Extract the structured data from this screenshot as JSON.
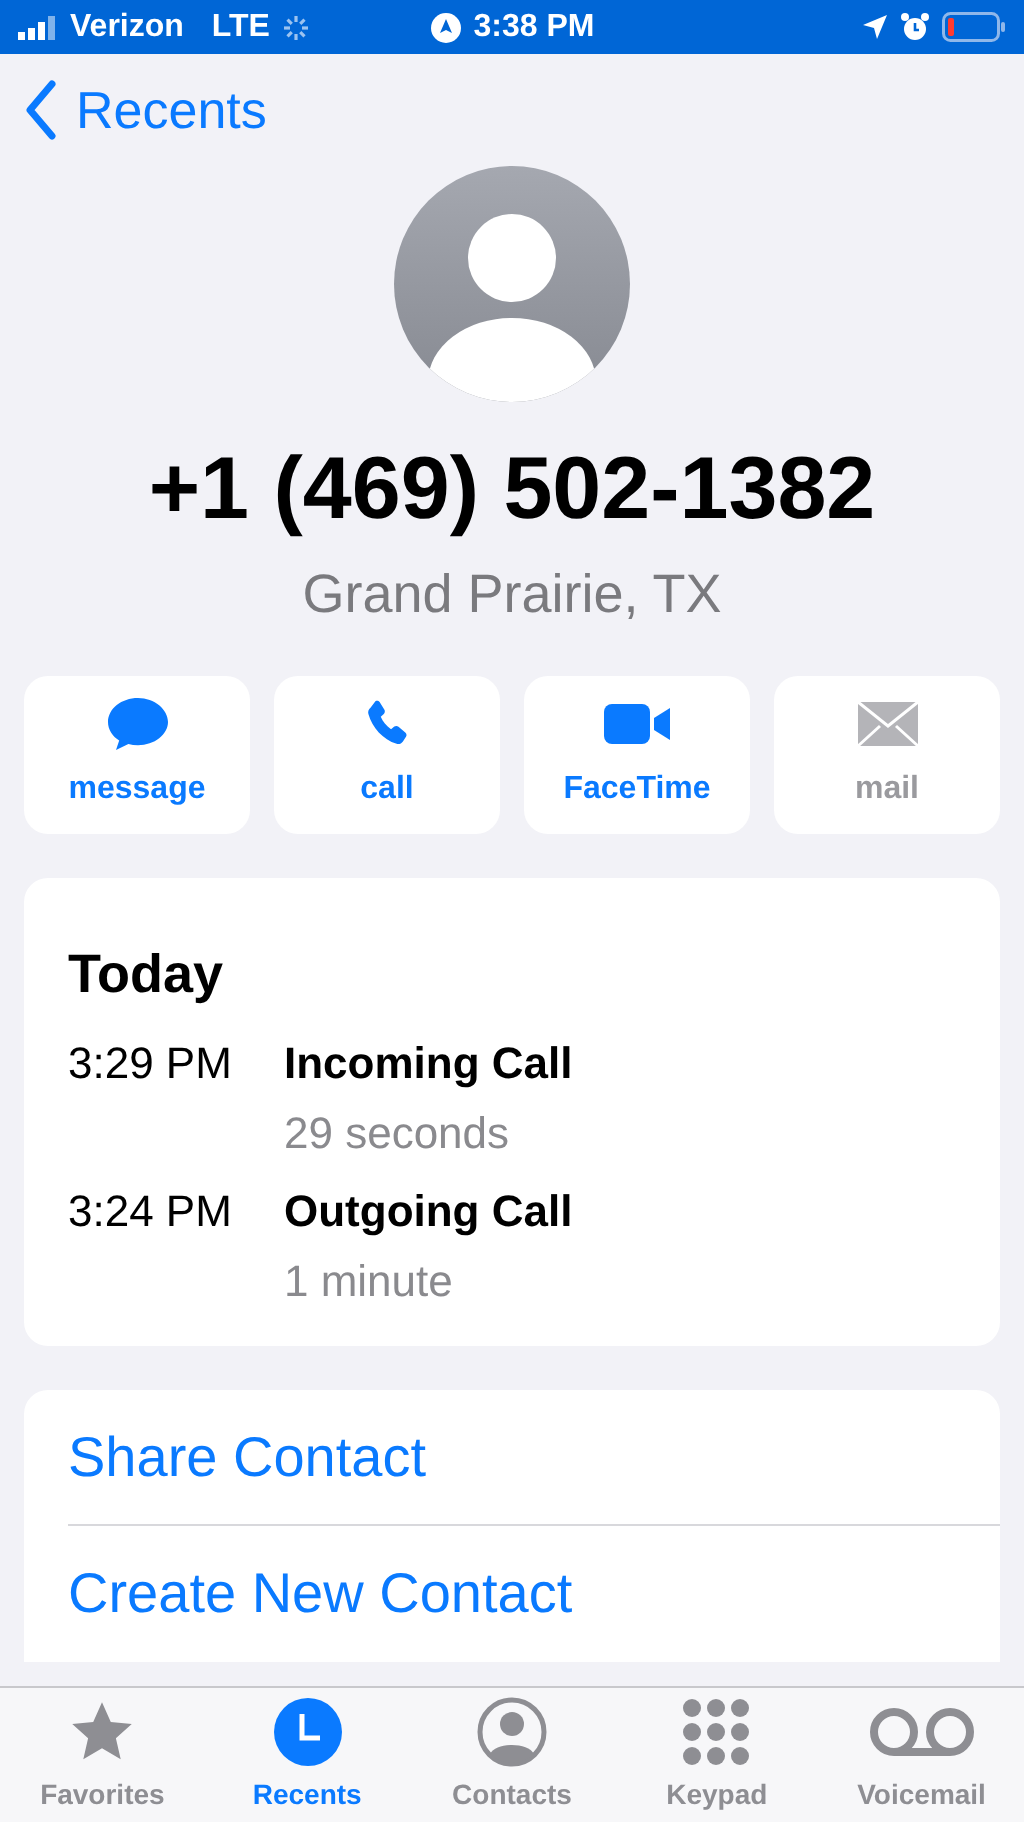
{
  "status_bar": {
    "carrier": "Verizon",
    "network": "LTE",
    "time": "3:38 PM"
  },
  "nav": {
    "back_label": "Recents"
  },
  "contact": {
    "phone": "+1 (469) 502-1382",
    "location": "Grand Prairie, TX"
  },
  "actions": [
    {
      "label": "message",
      "disabled": false
    },
    {
      "label": "call",
      "disabled": false
    },
    {
      "label": "FaceTime",
      "disabled": false
    },
    {
      "label": "mail",
      "disabled": true
    }
  ],
  "history": {
    "heading": "Today",
    "calls": [
      {
        "time": "3:29 PM",
        "type": "Incoming Call",
        "duration": "29 seconds"
      },
      {
        "time": "3:24 PM",
        "type": "Outgoing Call",
        "duration": "1 minute"
      }
    ]
  },
  "links": [
    "Share Contact",
    "Create New Contact"
  ],
  "tabs": [
    {
      "label": "Favorites",
      "selected": false
    },
    {
      "label": "Recents",
      "selected": true
    },
    {
      "label": "Contacts",
      "selected": false
    },
    {
      "label": "Keypad",
      "selected": false
    },
    {
      "label": "Voicemail",
      "selected": false
    }
  ]
}
